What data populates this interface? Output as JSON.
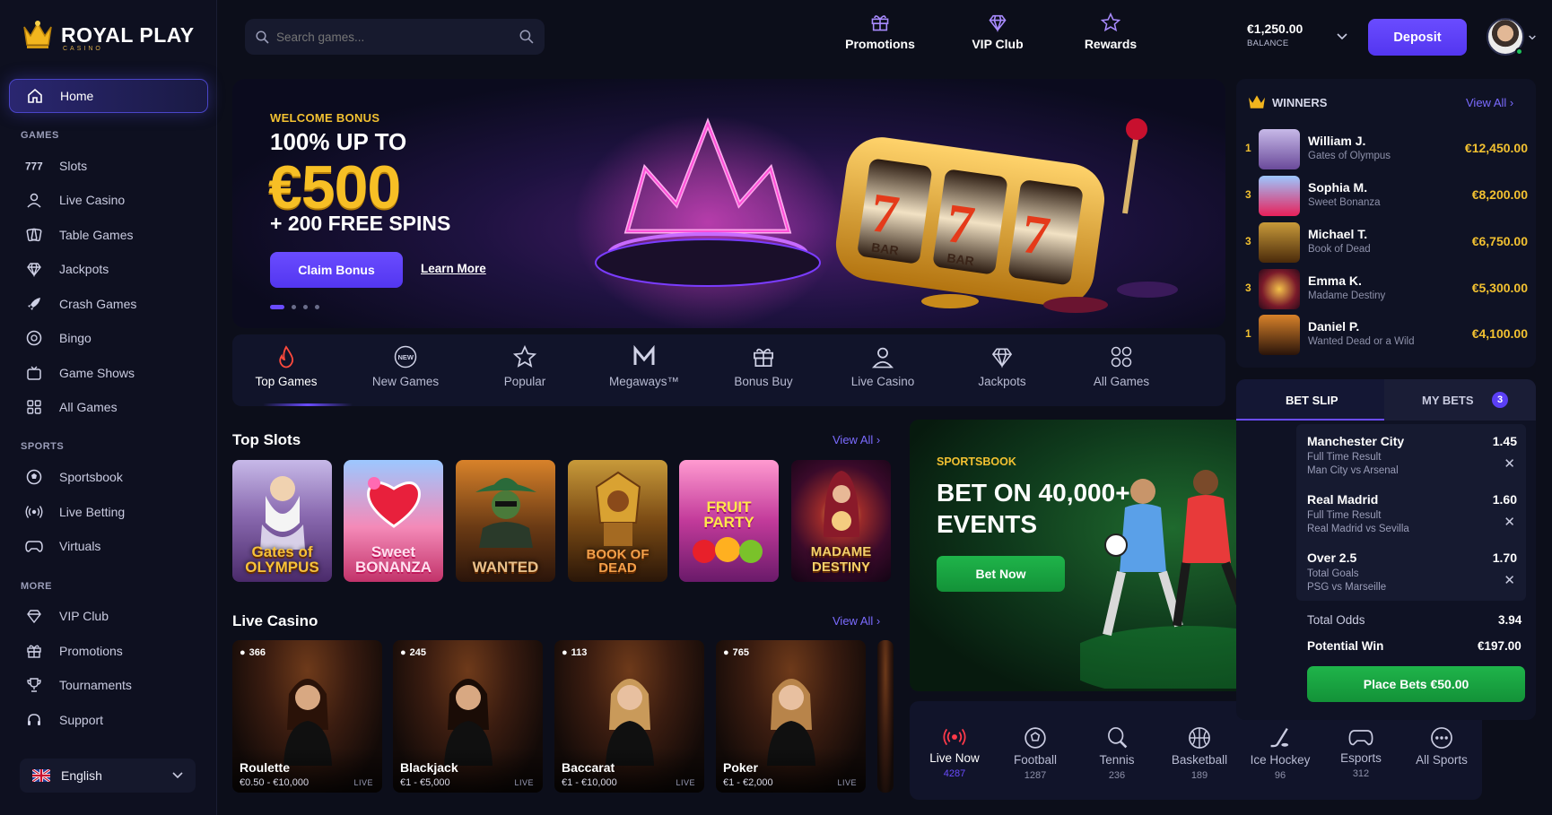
{
  "brand": {
    "name": "ROYAL PLAY",
    "sub": "CASINO"
  },
  "sidebar": {
    "home": "Home",
    "sections": {
      "games": "GAMES",
      "sports": "SPORTS",
      "more": "MORE"
    },
    "games": [
      "Slots",
      "Live Casino",
      "Table Games",
      "Jackpots",
      "Crash Games",
      "Bingo",
      "Game Shows",
      "All Games"
    ],
    "sports": [
      "Sportsbook",
      "Live Betting",
      "Virtuals"
    ],
    "more": [
      "VIP Club",
      "Promotions",
      "Tournaments",
      "Support"
    ],
    "language": "English"
  },
  "header": {
    "search_placeholder": "Search games...",
    "nav": [
      "Promotions",
      "VIP Club",
      "Rewards"
    ],
    "balance": "€1,250.00",
    "balance_label": "BALANCE",
    "deposit": "Deposit"
  },
  "hero": {
    "tag": "WELCOME BONUS",
    "line1": "100% UP TO",
    "amount": "€500",
    "line3": "+ 200 FREE SPINS",
    "cta": "Claim Bonus",
    "link": "Learn More",
    "slides_total": 4,
    "slide_active": 1
  },
  "categories": [
    "Top Games",
    "New Games",
    "Popular",
    "Megaways™",
    "Bonus Buy",
    "Live Casino",
    "Jackpots",
    "All Games"
  ],
  "top_slots": {
    "title": "Top Slots",
    "view_all": "View All",
    "items": [
      "Gates of OLYMPUS",
      "Sweet BONANZA",
      "WANTED",
      "BOOK OF DEAD",
      "FRUIT PARTY",
      "MADAME DESTINY"
    ]
  },
  "live_casino": {
    "title": "Live Casino",
    "view_all": "View All",
    "items": [
      {
        "name": "Roulette",
        "players": "366",
        "limits": "€0.50 - €10,000"
      },
      {
        "name": "Blackjack",
        "players": "245",
        "limits": "€1 - €5,000"
      },
      {
        "name": "Baccarat",
        "players": "113",
        "limits": "€1 - €10,000"
      },
      {
        "name": "Poker",
        "players": "765",
        "limits": "€1 - €2,000"
      }
    ],
    "live_label": "LIVE"
  },
  "sportsbook": {
    "tag": "SPORTSBOOK",
    "headline": "BET ON 40,000+ EVENTS",
    "cta": "Bet Now"
  },
  "sports_bar": [
    {
      "name": "Live Now",
      "count": "4287"
    },
    {
      "name": "Football",
      "count": "1287"
    },
    {
      "name": "Tennis",
      "count": "236"
    },
    {
      "name": "Basketball",
      "count": "189"
    },
    {
      "name": "Ice Hockey",
      "count": "96"
    },
    {
      "name": "Esports",
      "count": "312"
    },
    {
      "name": "All Sports",
      "count": ""
    }
  ],
  "winners": {
    "title": "WINNERS",
    "view_all": "View All",
    "rows": [
      {
        "rank": "1",
        "name": "William J.",
        "game": "Gates of Olympus",
        "amount": "€12,450.00"
      },
      {
        "rank": "3",
        "name": "Sophia M.",
        "game": "Sweet Bonanza",
        "amount": "€8,200.00"
      },
      {
        "rank": "3",
        "name": "Michael T.",
        "game": "Book of Dead",
        "amount": "€6,750.00"
      },
      {
        "rank": "3",
        "name": "Emma K.",
        "game": "Madame Destiny",
        "amount": "€5,300.00"
      },
      {
        "rank": "1",
        "name": "Daniel P.",
        "game": "Wanted Dead or a Wild",
        "amount": "€4,100.00"
      }
    ]
  },
  "bet_slip": {
    "tab_slip": "BET SLIP",
    "tab_bets": "MY BETS",
    "bets_count": "3",
    "selections": [
      {
        "team": "Manchester City",
        "market": "Full Time Result",
        "game": "Man City vs Arsenal",
        "odds": "1.45"
      },
      {
        "team": "Real Madrid",
        "market": "Full Time Result",
        "game": "Real Madrid vs Sevilla",
        "odds": "1.60"
      },
      {
        "team": "Over 2.5",
        "market": "Total Goals",
        "game": "PSG vs Marseille",
        "odds": "1.70"
      }
    ],
    "total_odds_label": "Total Odds",
    "total_odds": "3.94",
    "potential_label": "Potential Win",
    "potential": "€197.00",
    "place": "Place Bets €50.00"
  },
  "colors": {
    "accent": "#5b3ff5",
    "gold": "#f2c131",
    "green": "#1aa742",
    "bg": "#0c0e1a"
  }
}
